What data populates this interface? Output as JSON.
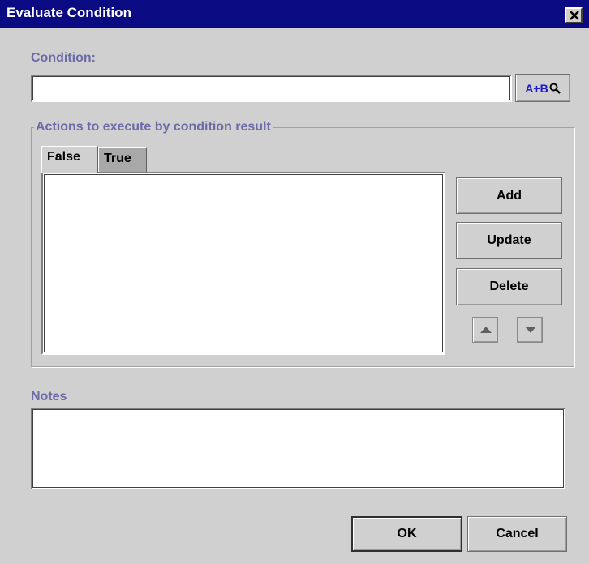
{
  "window": {
    "title": "Evaluate Condition",
    "close_icon": "close-icon"
  },
  "condition": {
    "label": "Condition:",
    "value": "",
    "placeholder": "",
    "expression_button_label": "A+B"
  },
  "actions": {
    "group_title": "Actions to execute by condition result",
    "tabs": [
      {
        "label": "False",
        "selected": true
      },
      {
        "label": "True",
        "selected": false
      }
    ],
    "items": [],
    "buttons": {
      "add": "Add",
      "update": "Update",
      "delete": "Delete"
    },
    "move_up_icon": "triangle-up-icon",
    "move_down_icon": "triangle-down-icon"
  },
  "notes": {
    "label": "Notes",
    "value": ""
  },
  "footer": {
    "ok": "OK",
    "cancel": "Cancel"
  },
  "colors": {
    "titlebar": "#0a0a82",
    "label_accent": "#6b6ba8",
    "background": "#d0d0d0",
    "expression_text": "#1a1acc"
  }
}
